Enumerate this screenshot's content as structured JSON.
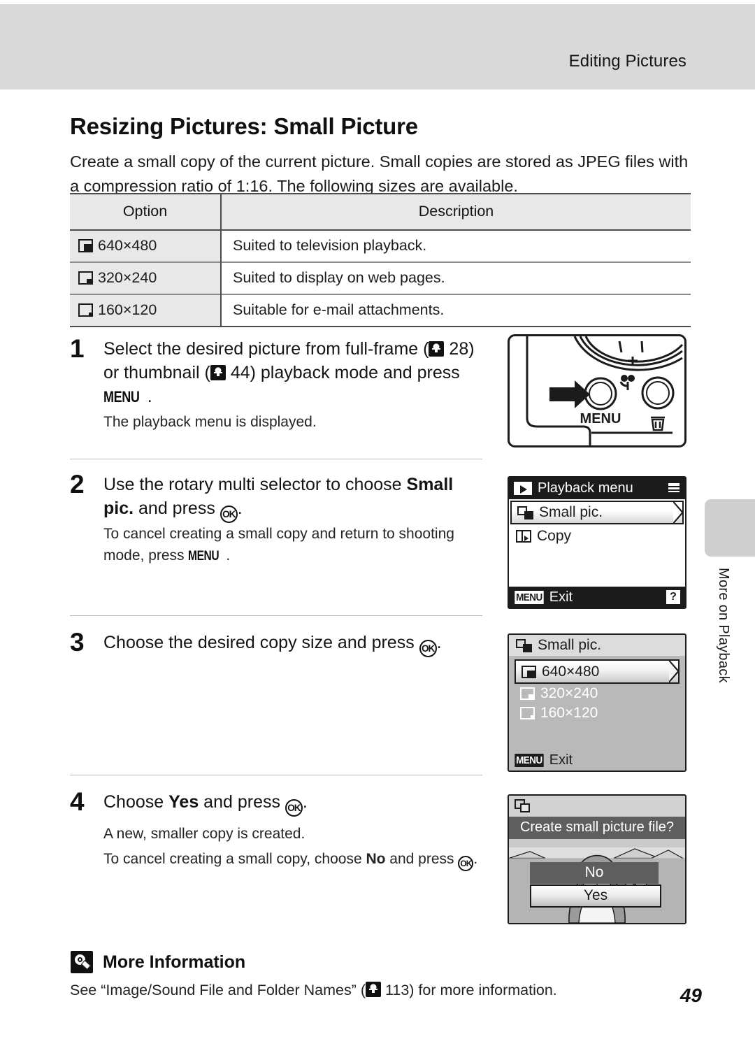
{
  "header": {
    "running_head": "Editing Pictures"
  },
  "title": "Resizing Pictures: Small Picture",
  "intro": "Create a small copy of the current picture. Small copies are stored as JPEG files with a compression ratio of 1:16. The following sizes are available.",
  "option_table": {
    "columns": [
      "Option",
      "Description"
    ],
    "rows": [
      {
        "option": "640×480",
        "description": "Suited to television playback."
      },
      {
        "option": "320×240",
        "description": "Suited to display on web pages."
      },
      {
        "option": "160×120",
        "description": "Suitable for e-mail attachments."
      }
    ]
  },
  "steps": [
    {
      "number": "1",
      "main_a": "Select the desired picture from full-frame (",
      "ref_a": "28",
      "main_b": ") or thumbnail (",
      "ref_b": "44",
      "main_c": ") playback mode and press ",
      "menu_label": "MENU",
      "main_d": ".",
      "sub": "The playback menu is displayed."
    },
    {
      "number": "2",
      "main_a": "Use the rotary multi selector to choose ",
      "bold_a": "Small pic.",
      "main_b": " and press ",
      "ok_label": "OK",
      "main_c": ".",
      "sub_a": "To cancel creating a small copy and return to shooting mode, press ",
      "menu_label": "MENU",
      "sub_b": "."
    },
    {
      "number": "3",
      "main_a": "Choose the desired copy size and press ",
      "ok_label": "OK",
      "main_b": "."
    },
    {
      "number": "4",
      "main_a": "Choose ",
      "bold_a": "Yes",
      "main_b": " and press ",
      "ok_label": "OK",
      "main_c": ".",
      "sub_1": "A new, smaller copy is created.",
      "sub_2a": "To cancel creating a small copy, choose ",
      "sub_2b": "No",
      "sub_2c": " and press ",
      "sub_2d": "."
    }
  ],
  "camera_illustration": {
    "menu_button_label": "MENU",
    "macro_icon": "flower-icon",
    "delete_icon": "trash-icon",
    "arrow_icon": "right-arrow-icon"
  },
  "playback_menu_screen": {
    "title": "Playback menu",
    "items": [
      {
        "label": "Small pic.",
        "selected": true
      },
      {
        "label": "Copy",
        "selected": false
      }
    ],
    "footer_badge": "MENU",
    "footer_label": "Exit",
    "help_badge": "?"
  },
  "small_pic_screen": {
    "title": "Small pic.",
    "items": [
      {
        "label": "640×480",
        "selected": true
      },
      {
        "label": "320×240",
        "selected": false
      },
      {
        "label": "160×120",
        "selected": false
      }
    ],
    "footer_badge": "MENU",
    "footer_label": "Exit"
  },
  "confirm_dialog": {
    "banner": "Create small picture file?",
    "no_label": "No",
    "yes_label": "Yes"
  },
  "side_tab": {
    "label": "More on Playback"
  },
  "more_information": {
    "heading": "More Information",
    "text_a": "See “Image/Sound File and Folder Names” (",
    "ref": "113",
    "text_b": ") for more information."
  },
  "page_number": "49",
  "colors": {
    "header_band": "#d9d9d9",
    "table_head": "#e8e8e8",
    "side_tab": "#cfcfcf",
    "lcd_dark": "#1b1b1b",
    "lcd_gray": "#b9b9b9"
  }
}
